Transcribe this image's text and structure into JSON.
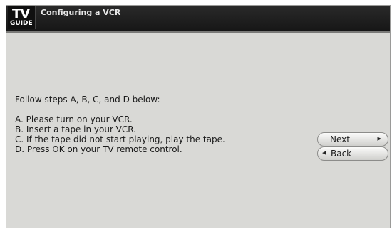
{
  "header": {
    "logo_tv": "TV",
    "logo_guide": "GUIDE",
    "title": "Configuring a VCR"
  },
  "main": {
    "intro": "Follow steps A, B, C, and D below:",
    "steps": [
      "A. Please turn on your VCR.",
      "B. Insert a tape in your VCR.",
      "C. If the tape did not start playing, play the tape.",
      "D. Press OK on your TV remote control."
    ]
  },
  "buttons": {
    "next_label": "Next",
    "back_label": "Back",
    "next_icon": "chevron-right-icon",
    "back_icon": "chevron-left-icon"
  }
}
